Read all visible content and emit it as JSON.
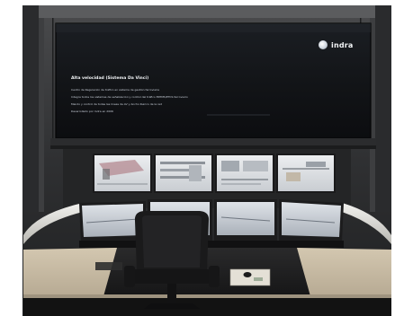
{
  "slide": {
    "brand": "indra",
    "logo": "indra-logo-mark",
    "heading": "Alta velocidad (Sistema Da Vinci)",
    "lines": [
      "Centro de Regulación de tráfico en sistema de gestión ferroviaria",
      "Integra todos los sistemas de señalización y control del tráfico ERTMS/ETCS ferroviario",
      "Mando y control de todas las líneas de AV y Ancho Ibérico de la red",
      "Desarrollado por Indra en 2006"
    ]
  },
  "scene": {
    "subject": "railway traffic control room workstation",
    "upper_monitor_count": 4,
    "lower_monitor_count": 4,
    "colors": {
      "wall_frame": "#3a3b3d",
      "screen_dark": "#0f1114",
      "desk_top": "#c7bba5",
      "floor": "#121212",
      "chair": "#1a1a1b"
    }
  }
}
